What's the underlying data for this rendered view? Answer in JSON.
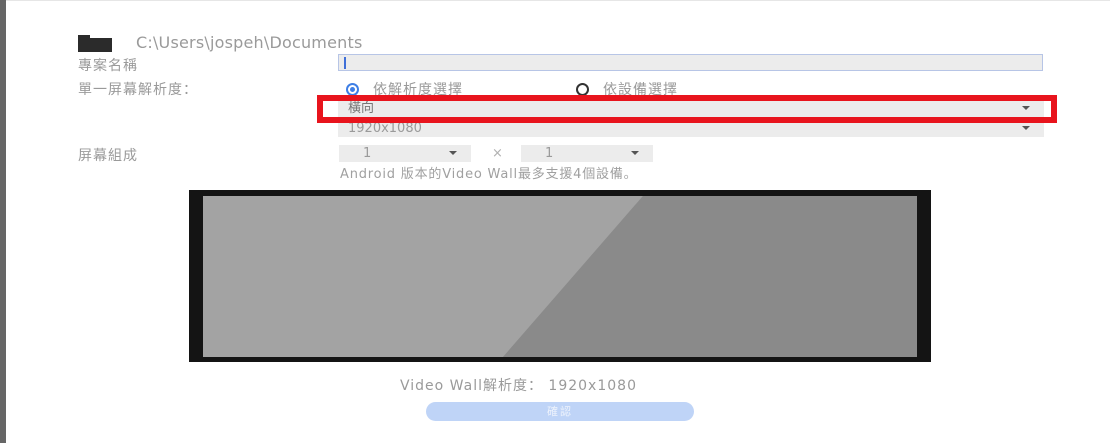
{
  "header": {
    "folder_icon": "folder-icon",
    "path": "C:\\Users\\jospeh\\Documents"
  },
  "form": {
    "project_name_label": "專案名稱",
    "project_name_value": "",
    "single_resolution_label": "單一屏幕解析度：",
    "radio_by_resolution": "依解析度選擇",
    "radio_by_device": "依設備選擇",
    "selected_radio": "依解析度選擇",
    "orientation_value": "橫向",
    "resolution_value": "1920x1080",
    "screen_layout_label": "屏幕組成",
    "columns_value": "1",
    "times_symbol": "×",
    "rows_value": "1",
    "note": "Android 版本的Video Wall最多支援4個設備。"
  },
  "preview": {
    "video_wall_resolution": "Video Wall解析度： 1920x1080"
  },
  "actions": {
    "confirm_label": "確認"
  },
  "colors": {
    "highlight_red": "#e8141d",
    "accent_blue": "#3f7fe5",
    "button_blue": "#bfd4f7"
  }
}
